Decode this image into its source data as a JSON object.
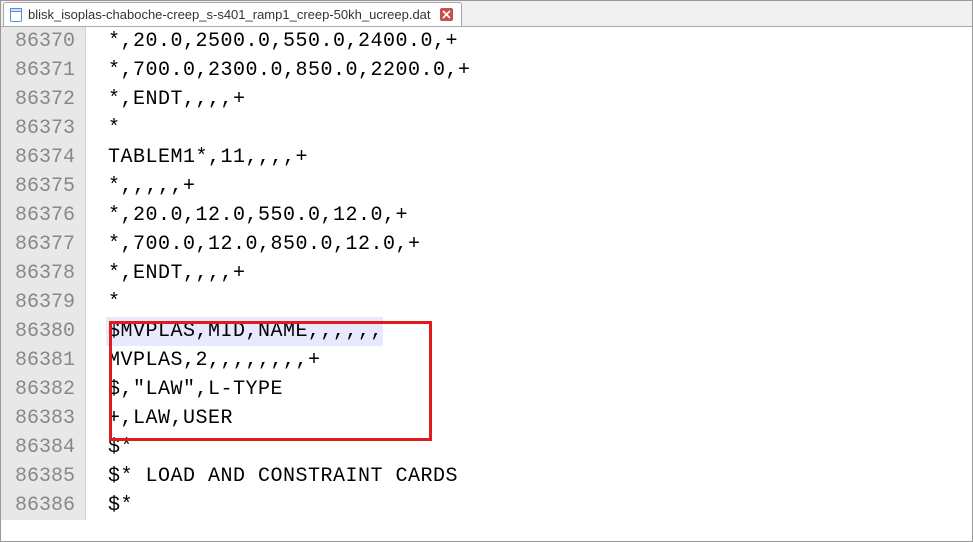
{
  "tab": {
    "filename": "blisk_isoplas-chaboche-creep_s-s401_ramp1_creep-50kh_ucreep.dat"
  },
  "lines": [
    {
      "num": "86370",
      "text": "*,20.0,2500.0,550.0,2400.0,+",
      "hl": false
    },
    {
      "num": "86371",
      "text": "*,700.0,2300.0,850.0,2200.0,+",
      "hl": false
    },
    {
      "num": "86372",
      "text": "*,ENDT,,,,+",
      "hl": false
    },
    {
      "num": "86373",
      "text": "*",
      "hl": false
    },
    {
      "num": "86374",
      "text": "TABLEM1*,11,,,,+",
      "hl": false
    },
    {
      "num": "86375",
      "text": "*,,,,,+",
      "hl": false
    },
    {
      "num": "86376",
      "text": "*,20.0,12.0,550.0,12.0,+",
      "hl": false
    },
    {
      "num": "86377",
      "text": "*,700.0,12.0,850.0,12.0,+",
      "hl": false
    },
    {
      "num": "86378",
      "text": "*,ENDT,,,,+",
      "hl": false
    },
    {
      "num": "86379",
      "text": "*",
      "hl": false
    },
    {
      "num": "86380",
      "text": "$MVPLAS,MID,NAME,,,,,,",
      "hl": true
    },
    {
      "num": "86381",
      "text": "MVPLAS,2,,,,,,,,+",
      "hl": false
    },
    {
      "num": "86382",
      "text": "$,\"LAW\",L-TYPE",
      "hl": false
    },
    {
      "num": "86383",
      "text": "+,LAW,USER",
      "hl": false
    },
    {
      "num": "86384",
      "text": "$*",
      "hl": false
    },
    {
      "num": "86385",
      "text": "$* LOAD AND CONSTRAINT CARDS",
      "hl": false
    },
    {
      "num": "86386",
      "text": "$*",
      "hl": false
    }
  ]
}
